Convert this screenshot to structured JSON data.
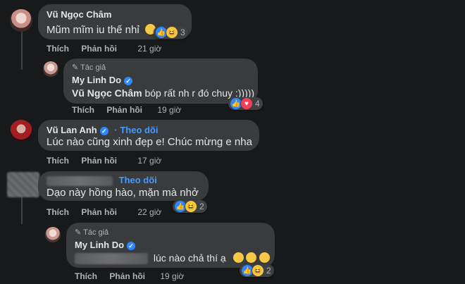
{
  "comments": [
    {
      "name": "Vũ Ngọc Châm",
      "text": "Mũm mĩm iu thế nhỉ",
      "like": "Thích",
      "reply": "Phản hồi",
      "time": "21 giờ",
      "reactions": "3"
    },
    {
      "author_tag": "Tác giả",
      "name": "My Linh Do",
      "text_name": "Vũ Ngọc Châm",
      "text": "bóp rất nh r đó chuy :)))))",
      "like": "Thích",
      "reply": "Phản hồi",
      "time": "19 giờ",
      "reactions": "4"
    },
    {
      "name": "Vũ Lan Anh",
      "follow": "Theo dõi",
      "text": "Lúc nào cũng xinh đẹp e! Chúc mừng e nha",
      "like": "Thích",
      "reply": "Phản hồi",
      "time": "17 giờ"
    },
    {
      "follow": "Theo dõi",
      "text": "Dạo này hồng hào, mặn mà nhở",
      "like": "Thích",
      "reply": "Phản hồi",
      "time": "22 giờ",
      "reactions": "2"
    },
    {
      "author_tag": "Tác giả",
      "name": "My Linh Do",
      "text": "lúc nào chả thí ạ",
      "like": "Thích",
      "reply": "Phản hồi",
      "time": "19 giờ",
      "reactions": "2"
    }
  ]
}
